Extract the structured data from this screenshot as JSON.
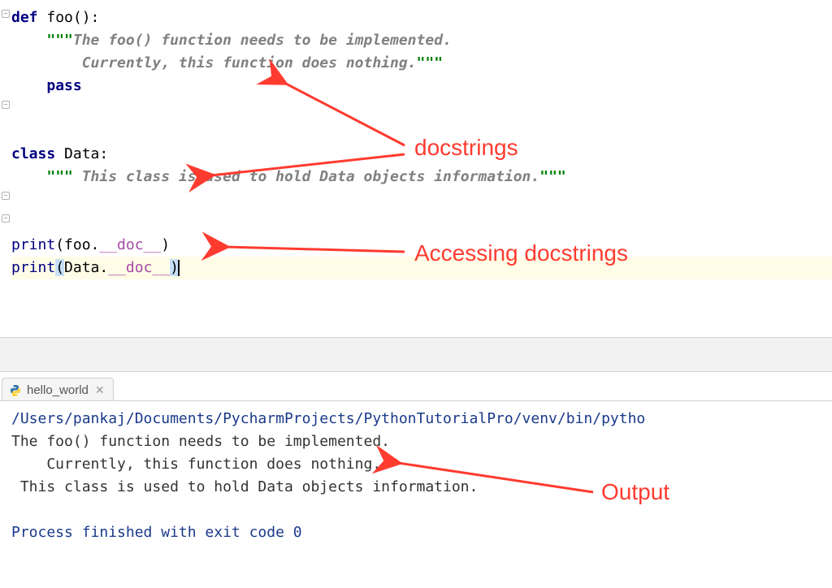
{
  "editor": {
    "lines": {
      "l1_def": "def ",
      "l1_name": "foo():",
      "l2_q": "\"\"\"",
      "l2_txt": "The foo() function needs to be implemented.",
      "l3_txt": "    Currently, this function does nothing.",
      "l3_q": "\"\"\"",
      "l4_pass": "pass",
      "l6_class": "class ",
      "l6_name": "Data:",
      "l7_q1": "\"\"\"",
      "l7_txt": " This class is used to hold Data objects information.",
      "l7_q2": "\"\"\"",
      "l9_print": "print",
      "l9_open": "(foo.",
      "l9_dunder": "__doc__",
      "l9_close": ")",
      "l10_print": "print",
      "l10_open": "(",
      "l10_mid": "Data.",
      "l10_dunder": "__doc__",
      "l10_close": ")"
    }
  },
  "annotations": {
    "docstrings": "docstrings",
    "accessing": "Accessing docstrings",
    "output": "Output"
  },
  "run_tab": {
    "name": "hello_world"
  },
  "console": {
    "path": "/Users/pankaj/Documents/PycharmProjects/PythonTutorialPro/venv/bin/pytho",
    "out1": "The foo() function needs to be implemented.",
    "out2": "    Currently, this function does nothing.",
    "out3": " This class is used to hold Data objects information.",
    "exit": "Process finished with exit code 0"
  }
}
